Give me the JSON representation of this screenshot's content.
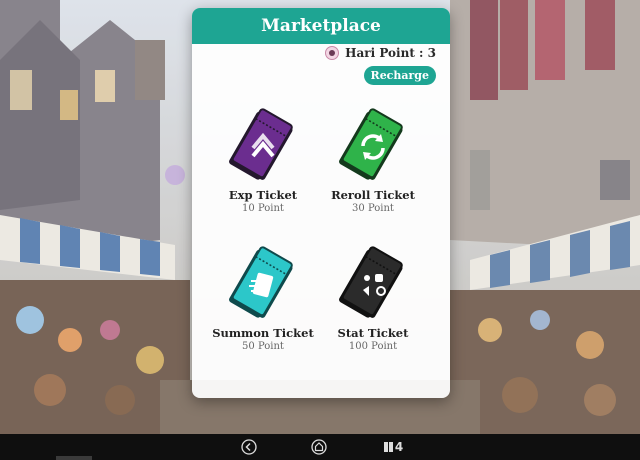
{
  "marketplace": {
    "title": "Marketplace",
    "points_text": "Hari Point : 3",
    "recharge_label": "Recharge",
    "items": [
      {
        "name": "Exp Ticket",
        "price": "10 Point",
        "badge": "EXP",
        "color": "#6b2d8f",
        "icon": "double-chevron-up-icon"
      },
      {
        "name": "Reroll Ticket",
        "price": "30 Point",
        "badge": "REROLL",
        "color": "#2fb34a",
        "icon": "refresh-arrows-icon"
      },
      {
        "name": "Summon Ticket",
        "price": "50 Point",
        "badge": "SUMMON",
        "color": "#2cc7c9",
        "icon": "summon-cards-icon"
      },
      {
        "name": "Stat Ticket",
        "price": "100 Point",
        "badge": "STAT",
        "color": "#2b2b2b",
        "icon": "stat-symbols-icon"
      }
    ]
  },
  "nav": {
    "icons": [
      "back-icon",
      "home-icon",
      "page-counter-icon"
    ],
    "page_count": "4"
  }
}
